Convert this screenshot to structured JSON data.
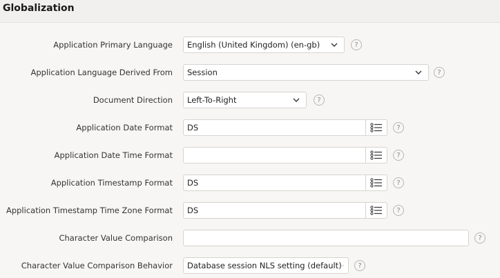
{
  "region": {
    "title": "Globalization"
  },
  "help_glyph": "?",
  "fields": [
    {
      "label": "Application Primary Language",
      "value": "English (United Kingdom) (en-gb)",
      "type": "select"
    },
    {
      "label": "Application Language Derived From",
      "value": "Session",
      "type": "select"
    },
    {
      "label": "Document Direction",
      "value": "Left-To-Right",
      "type": "select"
    },
    {
      "label": "Application Date Format",
      "value": "DS",
      "type": "lov"
    },
    {
      "label": "Application Date Time Format",
      "value": "",
      "type": "lov"
    },
    {
      "label": "Application Timestamp Format",
      "value": "DS",
      "type": "lov"
    },
    {
      "label": "Application Timestamp Time Zone Format",
      "value": "DS",
      "type": "lov"
    },
    {
      "label": "Character Value Comparison",
      "value": "",
      "type": "text"
    },
    {
      "label": "Character Value Comparison Behavior",
      "value": "Database session NLS setting (default)",
      "type": "select"
    }
  ],
  "icons": {
    "select": "chevron-down-icon",
    "lov": "list-icon",
    "help": "help-icon"
  }
}
